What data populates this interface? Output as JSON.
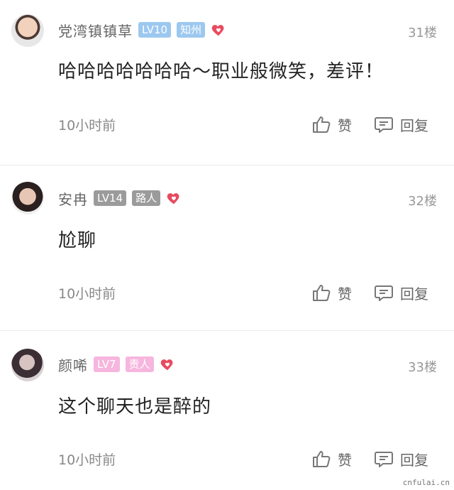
{
  "comments": [
    {
      "username": "党湾镇镇草",
      "level": "LV10",
      "tag": "知州",
      "floor": "31楼",
      "content": "哈哈哈哈哈哈哈～职业般微笑，差评！",
      "time": "10小时前",
      "like_label": "赞",
      "reply_label": "回复",
      "badge_color": "#9cc8ef"
    },
    {
      "username": "安冉",
      "level": "LV14",
      "tag": "路人",
      "floor": "32楼",
      "content": "尬聊",
      "time": "10小时前",
      "like_label": "赞",
      "reply_label": "回复",
      "badge_color": "#9b9b9b"
    },
    {
      "username": "颜唏",
      "level": "LV7",
      "tag": "责人",
      "floor": "33楼",
      "content": "这个聊天也是醉的",
      "time": "10小时前",
      "like_label": "赞",
      "reply_label": "回复",
      "badge_color": "#f6b6de"
    }
  ],
  "icons": {
    "heart": "heart-icon",
    "like": "thumbs-up-icon",
    "reply": "comment-bubble-icon"
  },
  "watermark": "cnfulai.cn"
}
